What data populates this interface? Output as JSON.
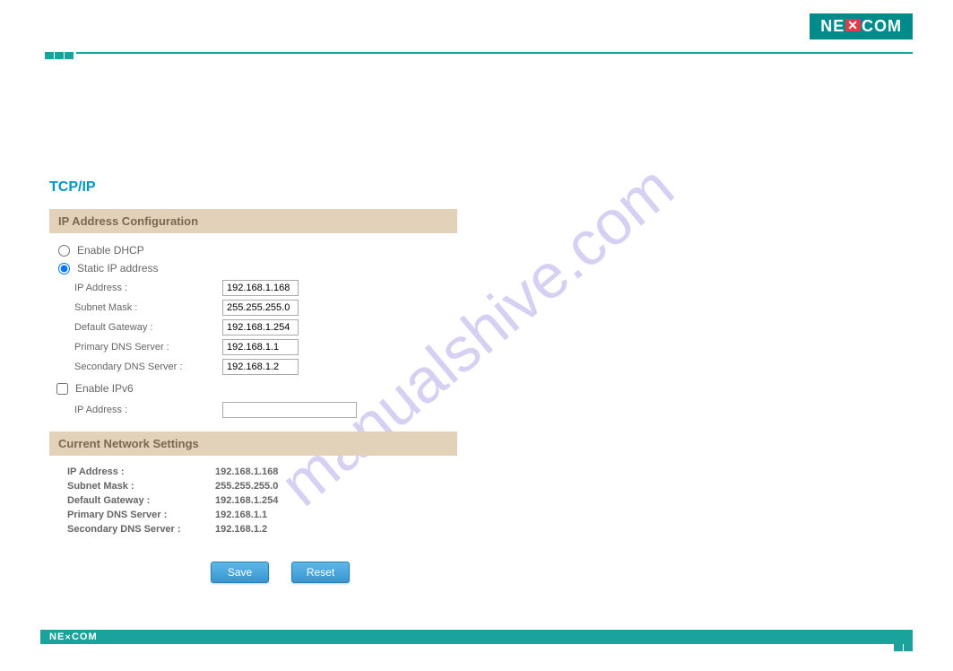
{
  "brand": "NEXCOM",
  "watermark": "manualshive.com",
  "page_title": "TCP/IP",
  "sections": {
    "ip_config": {
      "header": "IP Address Configuration",
      "dhcp_label": "Enable DHCP",
      "static_label": "Static IP address",
      "ipv6_label": "Enable IPv6",
      "fields": {
        "ip_label": "IP Address :",
        "ip_value": "192.168.1.168",
        "subnet_label": "Subnet Mask :",
        "subnet_value": "255.255.255.0",
        "gateway_label": "Default Gateway :",
        "gateway_value": "192.168.1.254",
        "primary_dns_label": "Primary DNS Server :",
        "primary_dns_value": "192.168.1.1",
        "secondary_dns_label": "Secondary DNS Server :",
        "secondary_dns_value": "192.168.1.2",
        "ipv6_ip_label": "IP Address :",
        "ipv6_ip_value": ""
      }
    },
    "current": {
      "header": "Current Network Settings",
      "fields": {
        "ip_label": "IP Address :",
        "ip_value": "192.168.1.168",
        "subnet_label": "Subnet Mask :",
        "subnet_value": "255.255.255.0",
        "gateway_label": "Default Gateway :",
        "gateway_value": "192.168.1.254",
        "primary_dns_label": "Primary DNS Server :",
        "primary_dns_value": "192.168.1.1",
        "secondary_dns_label": "Secondary DNS Server :",
        "secondary_dns_value": "192.168.1.2"
      }
    }
  },
  "buttons": {
    "save": "Save",
    "reset": "Reset"
  }
}
